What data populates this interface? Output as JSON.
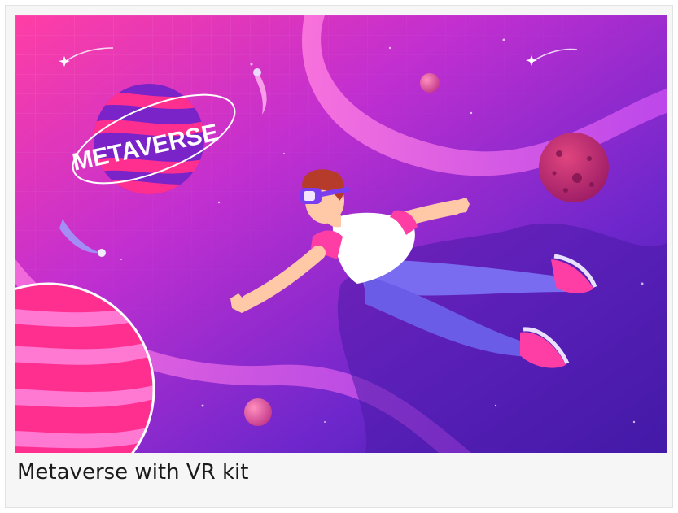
{
  "card": {
    "caption": "Metaverse with VR kit",
    "image": {
      "planet_label": "METAVERSE",
      "icons": [
        "planet-icon",
        "comet-icon",
        "shooting-star-icon",
        "astronaut-with-vr-headset"
      ]
    }
  },
  "colors": {
    "bg_top_left": "#ff3ea5",
    "bg_mid": "#9a2fd4",
    "bg_bottom_right": "#3a1aa8",
    "planet_stripe": "#ff2f90",
    "planet_purple": "#7a23c8",
    "caption_text": "#1b1b1b"
  }
}
